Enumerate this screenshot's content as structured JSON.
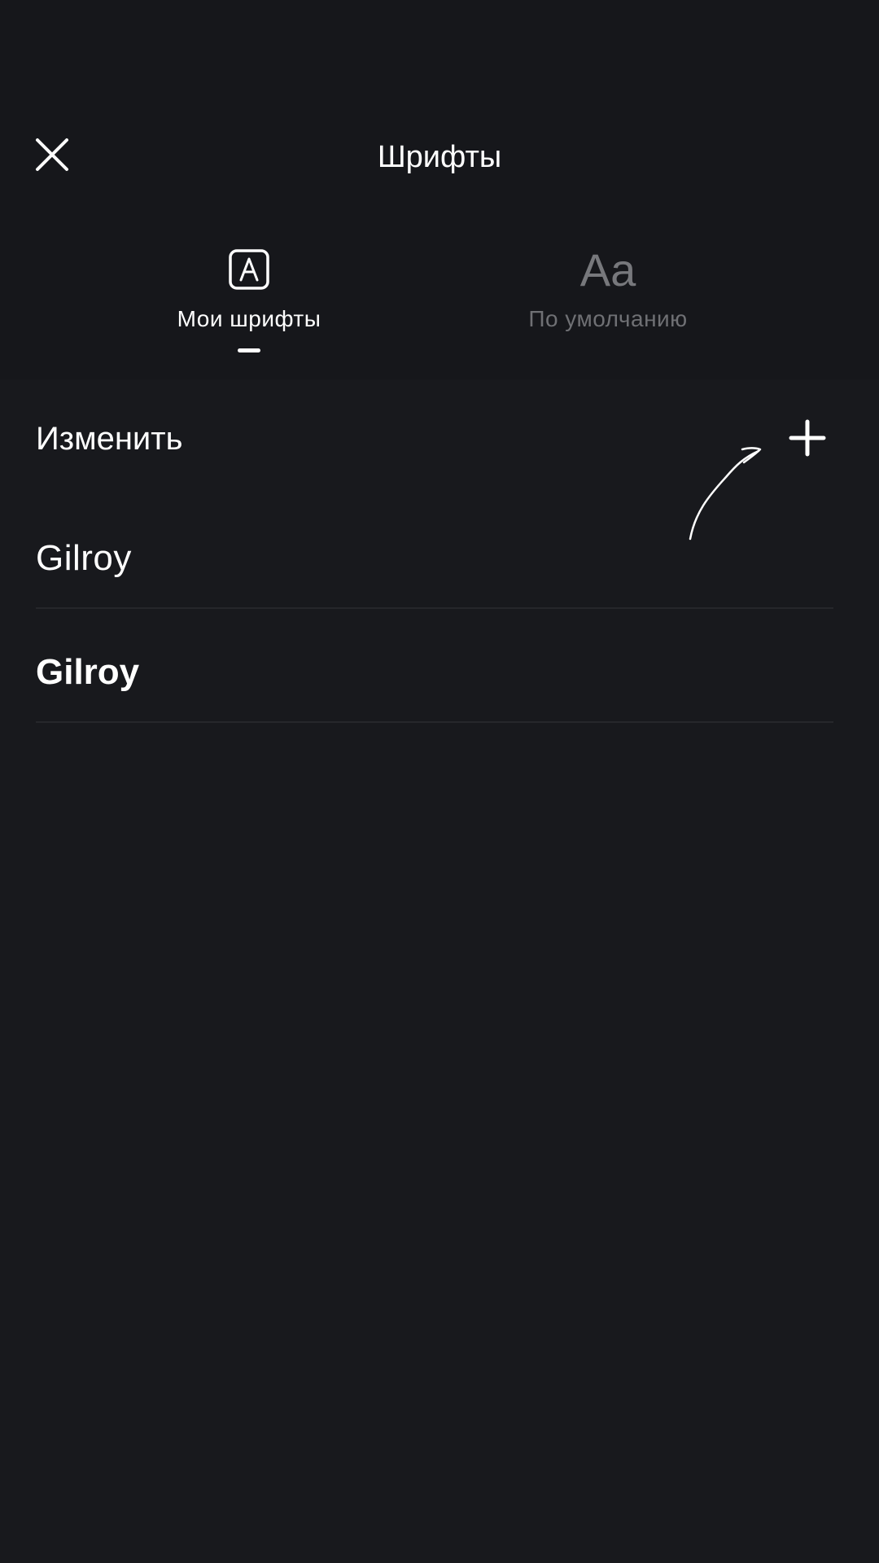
{
  "header": {
    "title": "Шрифты",
    "close_icon": "close-icon"
  },
  "tabs": [
    {
      "label": "Мои шрифты",
      "icon": "font-box-icon",
      "active": true
    },
    {
      "label": "По умолчанию",
      "icon_text": "Aa",
      "active": false
    }
  ],
  "toolbar": {
    "edit_label": "Изменить",
    "add_icon": "plus-icon"
  },
  "fonts": [
    {
      "name": "Gilroy",
      "weight": "light"
    },
    {
      "name": "Gilroy",
      "weight": "bold"
    }
  ],
  "colors": {
    "background": "#18191d",
    "active_text": "#ffffff",
    "inactive_text": "#6f7074",
    "divider": "#26272b"
  }
}
